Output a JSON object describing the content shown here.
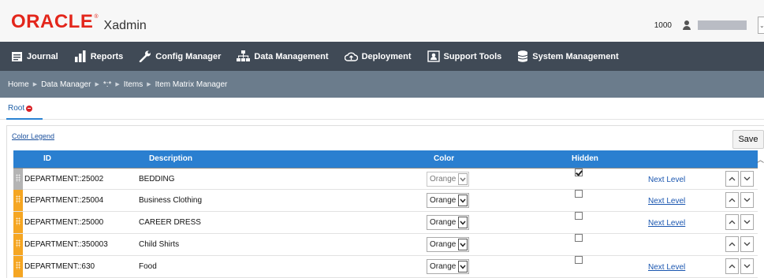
{
  "app": {
    "brand": "ORACLE",
    "brand_mark": "®",
    "product": "Xadmin"
  },
  "user": {
    "store_number": "1000",
    "menu_glyph": "⌄"
  },
  "nav": {
    "items": [
      {
        "label": "Journal",
        "icon": "journal-icon"
      },
      {
        "label": "Reports",
        "icon": "bar-chart-icon"
      },
      {
        "label": "Config Manager",
        "icon": "wrench-icon"
      },
      {
        "label": "Data Management",
        "icon": "hierarchy-icon"
      },
      {
        "label": "Deployment",
        "icon": "cloud-icon"
      },
      {
        "label": "Support Tools",
        "icon": "support-icon"
      },
      {
        "label": "System Management",
        "icon": "database-icon"
      }
    ]
  },
  "breadcrumb": {
    "items": [
      "Home",
      "Data Manager",
      "*:*",
      "Items",
      "Item Matrix Manager"
    ],
    "separator": "▶"
  },
  "tab": {
    "label": "Root",
    "accent": "#2a83d2",
    "badge_color": "#d92125"
  },
  "panel": {
    "legend_link": "Color Legend",
    "save_label": "Save"
  },
  "grid": {
    "header_color": "#2a7fd0",
    "columns": {
      "id": "ID",
      "description": "Description",
      "color": "Color",
      "hidden": "Hidden"
    },
    "rows": [
      {
        "id": "DEPARTMENT::25002",
        "description": "BEDDING",
        "color": "Orange",
        "hidden": true,
        "next_level": "Next Level",
        "handle": "gray"
      },
      {
        "id": "DEPARTMENT::25004",
        "description": "Business Clothing",
        "color": "Orange",
        "hidden": false,
        "next_level": "Next Level",
        "handle": "orange"
      },
      {
        "id": "DEPARTMENT::25000",
        "description": "CAREER DRESS",
        "color": "Orange",
        "hidden": false,
        "next_level": "Next Level",
        "handle": "orange"
      },
      {
        "id": "DEPARTMENT::350003",
        "description": "Child Shirts",
        "color": "Orange",
        "hidden": false,
        "next_level": "",
        "handle": "orange"
      },
      {
        "id": "DEPARTMENT::630",
        "description": "Food",
        "color": "Orange",
        "hidden": false,
        "next_level": "Next Level",
        "handle": "orange"
      }
    ]
  }
}
